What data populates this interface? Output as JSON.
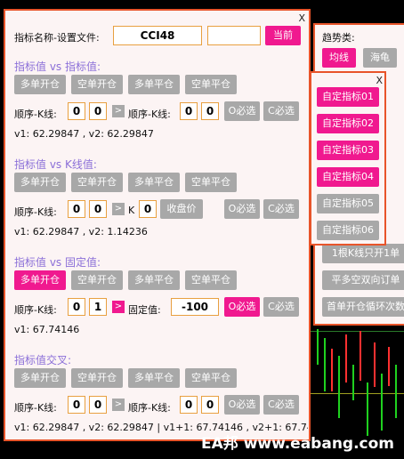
{
  "main": {
    "close": "X",
    "name_label": "指标名称-设置文件:",
    "name_value": "CCI48",
    "current_button": "当前",
    "sections": [
      {
        "title": "指标值 vs 指标值:",
        "buttons": [
          "多单开仓",
          "空单开仓",
          "多单平仓",
          "空单平仓"
        ],
        "row_label1": "顺序-K线:",
        "v1a": "0",
        "v1b": "0",
        "arrow": ">",
        "row_label2": "顺序-K线:",
        "v2a": "0",
        "v2b": "0",
        "o_label": "O必选",
        "c_label": "C必选",
        "values": "v1: 62.29847 , v2: 62.29847"
      },
      {
        "title": "指标值 vs K线值:",
        "buttons": [
          "多单开仓",
          "空单开仓",
          "多单平仓",
          "空单平仓"
        ],
        "row_label1": "顺序-K线:",
        "v1a": "0",
        "v1b": "0",
        "arrow": ">",
        "k_label": "K",
        "k_value": "0",
        "close_price": "收盘价",
        "o_label": "O必选",
        "c_label": "C必选",
        "values": "v1: 62.29847 , v2: 1.14236"
      },
      {
        "title": "指标值 vs 固定值:",
        "buttons": [
          "多单开仓",
          "空单开仓",
          "多单平仓",
          "空单平仓"
        ],
        "row_label1": "顺序-K线:",
        "v1a": "0",
        "v1b": "1",
        "arrow": ">",
        "fixed_label": "固定值:",
        "fixed_value": "-100",
        "o_label": "O必选",
        "c_label": "C必选",
        "values": "v1: 67.74146"
      },
      {
        "title": "指标值交叉:",
        "buttons": [
          "多单开仓",
          "空单开仓",
          "多单平仓",
          "空单平仓"
        ],
        "row_label1": "顺序-K线:",
        "v1a": "0",
        "v1b": "0",
        "arrow": ">",
        "row_label2": "顺序-K线:",
        "v2a": "0",
        "v2b": "0",
        "o_label": "O必选",
        "c_label": "C必选",
        "values": "v1: 62.29847 , v2: 62.29847 | v1+1: 67.74146 , v2+1: 67.74"
      }
    ]
  },
  "right": {
    "trend_label": "趋势类:",
    "trend_btn1": "均线",
    "trend_btn2": "海龟",
    "line1": "1根K线只开1单",
    "line2": "平多空双向订单",
    "line3": "首单开仓循环次数"
  },
  "popup": {
    "close": "X",
    "items": [
      "自定指标01",
      "自定指标02",
      "自定指标03",
      "自定指标04",
      "自定指标05",
      "自定指标06"
    ]
  },
  "watermark": "EA邦 www.eabang.com",
  "colors": {
    "accent_pink": "#f0198f",
    "border_orange": "#e8542a",
    "section_purple": "#8b6fd8",
    "gray_button": "#a8a8a8"
  }
}
